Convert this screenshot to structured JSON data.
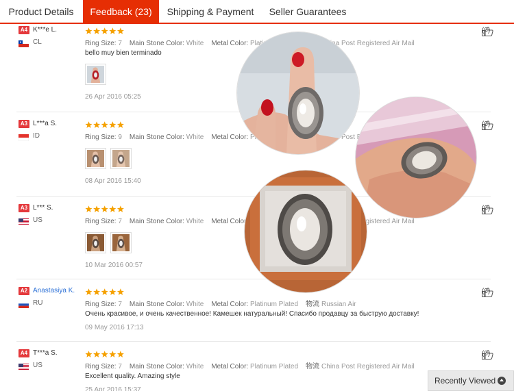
{
  "tabs": [
    {
      "label": "Product Details",
      "active": false
    },
    {
      "label": "Feedback (23)",
      "active": true
    },
    {
      "label": "Shipping & Payment",
      "active": false
    },
    {
      "label": "Seller Guarantees",
      "active": false
    }
  ],
  "attr_labels": {
    "ring_size": "Ring Size:",
    "stone_color": "Main Stone Color:",
    "metal_color": "Metal Color:",
    "ship_icon": "物流"
  },
  "reviews": [
    {
      "level": "A4",
      "name": "K***e L.",
      "country": "CL",
      "flag": "chile",
      "rating": 5,
      "ring_size": "7",
      "stone_color": "White",
      "metal_color": "Platinum Plated",
      "shipping": "China Post Registered Air Mail",
      "comment": "bello muy bien terminado",
      "photos": [
        "hand-photo"
      ],
      "date": "26 Apr 2016 05:25",
      "helpful": "(0)"
    },
    {
      "level": "A3",
      "name": "L***a S.",
      "country": "ID",
      "flag": "indonesia",
      "rating": 5,
      "ring_size": "9",
      "stone_color": "White",
      "metal_color": "Platinum Plated",
      "shipping": "China Post Registered Air Mail",
      "comment": "",
      "photos": [
        "finger-photo",
        "finger-photo-2"
      ],
      "date": "08 Apr 2016 15:40",
      "helpful": "(0)"
    },
    {
      "level": "A3",
      "name": "L*** S.",
      "country": "US",
      "flag": "usa",
      "rating": 5,
      "ring_size": "7",
      "stone_color": "White",
      "metal_color": "Platinum Plated",
      "shipping": "China Post Registered Air Mail",
      "comment": "",
      "photos": [
        "box-photo",
        "box-photo-2"
      ],
      "date": "10 Mar 2016 00:57",
      "helpful": "(0)"
    },
    {
      "level": "A2",
      "name": "Anastasiya K.",
      "country": "RU",
      "flag": "russia",
      "rating": 5,
      "ring_size": "7",
      "stone_color": "White",
      "metal_color": "Platinum Plated",
      "shipping": "Russian Air",
      "comment": "Очень красивое, и очень качественное! Камешек натуральный! Спасибо продавцу за быструю доставку!",
      "photos": [],
      "date": "09 May 2016 17:13",
      "helpful": "(0)"
    },
    {
      "level": "A4",
      "name": "T***a S.",
      "country": "US",
      "flag": "usa",
      "rating": 5,
      "ring_size": "7",
      "stone_color": "White",
      "metal_color": "Platinum Plated",
      "shipping": "China Post Registered Air Mail",
      "comment": "Excellent quality. Amazing style",
      "photos": [],
      "date": "25 Apr 2016 15:37",
      "helpful": "(0)"
    }
  ],
  "recently_viewed": "Recently Viewed",
  "colors": {
    "accent": "#e62e04",
    "star": "#f5a100",
    "level_badge": "#e4393c",
    "link": "#2a6fd6"
  }
}
